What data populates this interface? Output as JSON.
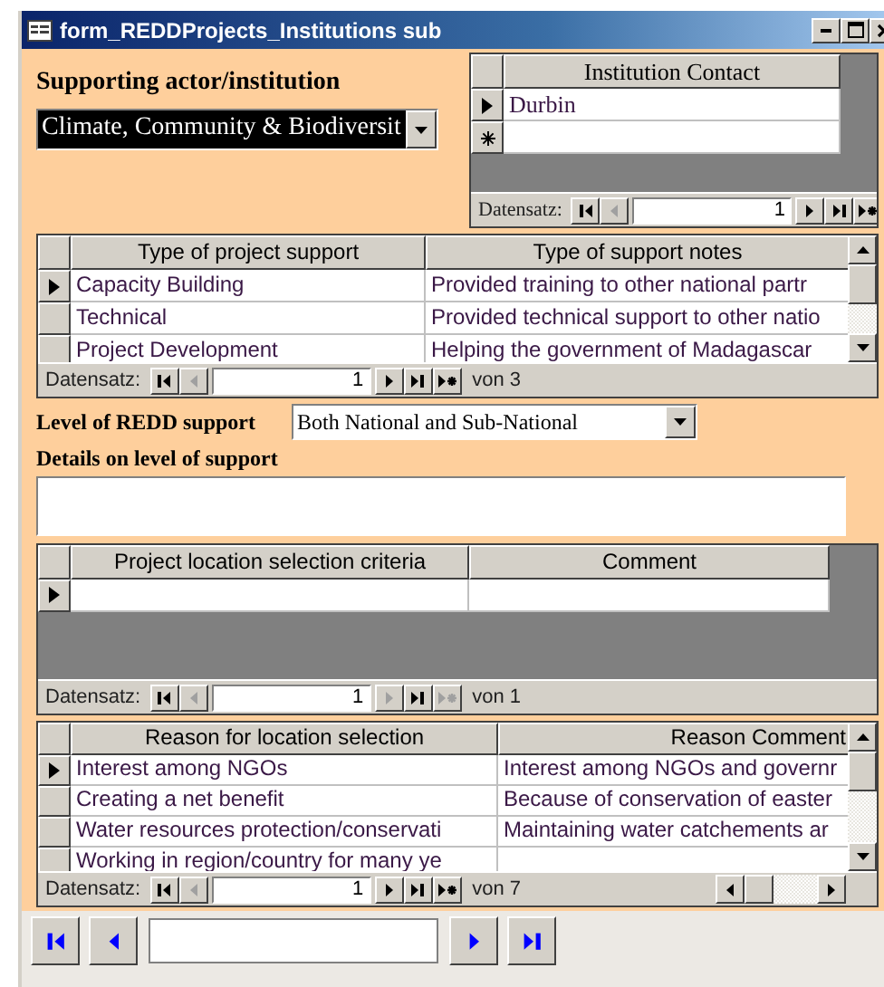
{
  "window": {
    "title": "form_REDDProjects_Institutions sub"
  },
  "actor": {
    "label": "Supporting actor/institution",
    "value": "Climate, Community & Biodiversit",
    "highlighted": true
  },
  "contacts": {
    "columns": [
      "Institution Contact"
    ],
    "rows": [
      {
        "cells": [
          "Durbin"
        ],
        "selected": true
      }
    ],
    "new_row": true,
    "navigator": {
      "label": "Datensatz:",
      "record": "1",
      "buttons": [
        {
          "kind": "first",
          "disabled": false
        },
        {
          "kind": "prev",
          "disabled": true
        },
        {
          "kind": "next",
          "disabled": false
        },
        {
          "kind": "last",
          "disabled": false
        },
        {
          "kind": "new",
          "disabled": false
        }
      ]
    }
  },
  "support_types": {
    "columns": [
      "Type of project support",
      "Type of support notes"
    ],
    "rows": [
      {
        "cells": [
          "Capacity Building",
          "Provided training to other national partr"
        ],
        "selected": true
      },
      {
        "cells": [
          "Technical",
          "Provided technical support to other natio"
        ],
        "selected": false
      },
      {
        "cells": [
          "Project Development",
          "Helping the government of Madagascar"
        ],
        "selected": false
      }
    ],
    "navigator": {
      "label": "Datensatz:",
      "record": "1",
      "count": "von 3",
      "buttons": [
        {
          "kind": "first",
          "disabled": false
        },
        {
          "kind": "prev",
          "disabled": true
        },
        {
          "kind": "next",
          "disabled": false
        },
        {
          "kind": "last",
          "disabled": false
        },
        {
          "kind": "new",
          "disabled": false
        }
      ]
    }
  },
  "level": {
    "label": "Level of REDD support",
    "value": "Both National and Sub-National"
  },
  "details": {
    "label": "Details on level of support"
  },
  "criteria": {
    "columns": [
      "Project location selection criteria",
      "Comment"
    ],
    "rows": [
      {
        "selected": true
      }
    ],
    "navigator": {
      "label": "Datensatz:",
      "record": "1",
      "count": "von 1",
      "buttons": [
        {
          "kind": "first",
          "disabled": false
        },
        {
          "kind": "prev",
          "disabled": true
        },
        {
          "kind": "next",
          "disabled": true
        },
        {
          "kind": "last",
          "disabled": false
        },
        {
          "kind": "new",
          "disabled": true
        }
      ]
    }
  },
  "reasons": {
    "columns": [
      "Reason for location selection",
      "Reason Comment"
    ],
    "rows": [
      {
        "cells": [
          "Interest among NGOs",
          "Interest among NGOs and governr"
        ],
        "selected": true
      },
      {
        "cells": [
          "Creating a net benefit",
          "Because of conservation of easter"
        ],
        "selected": false
      },
      {
        "cells": [
          "Water resources protection/conservati",
          "Maintaining water catchements ar"
        ],
        "selected": false
      },
      {
        "cells": [
          "Working in region/country for many ye"
        ],
        "selected": false
      }
    ],
    "navigator": {
      "label": "Datensatz:",
      "record": "1",
      "count": "von 7",
      "buttons": [
        {
          "kind": "first",
          "disabled": false
        },
        {
          "kind": "prev",
          "disabled": true
        },
        {
          "kind": "next",
          "disabled": false
        },
        {
          "kind": "last",
          "disabled": false
        },
        {
          "kind": "new",
          "disabled": false
        }
      ]
    }
  },
  "form_navigator": {
    "buttons": [
      {
        "kind": "first",
        "disabled": false
      },
      {
        "kind": "prev",
        "disabled": false
      },
      {
        "kind": "next",
        "disabled": false
      },
      {
        "kind": "last",
        "disabled": false
      }
    ]
  }
}
